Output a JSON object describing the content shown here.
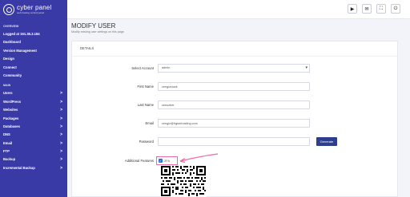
{
  "sidebar": {
    "logo": {
      "title": "cyber panel",
      "subtitle": "web hosting control panel"
    },
    "overview_heading": "OVERVIEW",
    "logged_at": "Logged at 161.35.3.184",
    "items_top": [
      {
        "label": "Dashboard"
      },
      {
        "label": "Version Management"
      },
      {
        "label": "Design"
      },
      {
        "label": "Connect"
      },
      {
        "label": "Community"
      }
    ],
    "main_heading": "MAIN",
    "items_main": [
      {
        "label": "Users",
        "chevron": ">"
      },
      {
        "label": "WordPress",
        "chevron": ">"
      },
      {
        "label": "Websites",
        "chevron": ">"
      },
      {
        "label": "Packages",
        "chevron": ">"
      },
      {
        "label": "Databases",
        "chevron": ">"
      },
      {
        "label": "DNS",
        "chevron": ">"
      },
      {
        "label": "Email",
        "chevron": ">"
      },
      {
        "label": "FTP",
        "chevron": ">"
      },
      {
        "label": "Backup",
        "chevron": ">"
      },
      {
        "label": "Incremental Backup",
        "chevron": ">"
      }
    ]
  },
  "topbar": {
    "buttons": [
      {
        "icon": "youtube-icon",
        "glyph": "▶"
      },
      {
        "icon": "chat-icon",
        "glyph": "✉"
      },
      {
        "icon": "expand-icon",
        "glyph": "⛶"
      },
      {
        "icon": "power-icon",
        "glyph": "⏻"
      }
    ]
  },
  "page": {
    "title": "MODIFY USER",
    "subtitle": "Modify existing user settings on this page."
  },
  "form": {
    "heading": "DETAILS",
    "select_account": {
      "label": "Select Account",
      "value": "admin",
      "arrow": "▾"
    },
    "first_name": {
      "label": "First Name",
      "value": "cengizcicek"
    },
    "last_name": {
      "label": "Last Name",
      "value": "cenozher"
    },
    "email": {
      "label": "Email",
      "value": "cengiz@hgserhosting.com"
    },
    "password": {
      "label": "Password",
      "value": ""
    },
    "generate_label": "Generate",
    "additional_features": {
      "label": "Additional Features",
      "option": "2FA",
      "checked": true,
      "check_glyph": "✓"
    }
  },
  "colors": {
    "sidebar": "#3a3aa6",
    "accent": "#2c3e8c",
    "highlight": "#ee6aa7"
  }
}
